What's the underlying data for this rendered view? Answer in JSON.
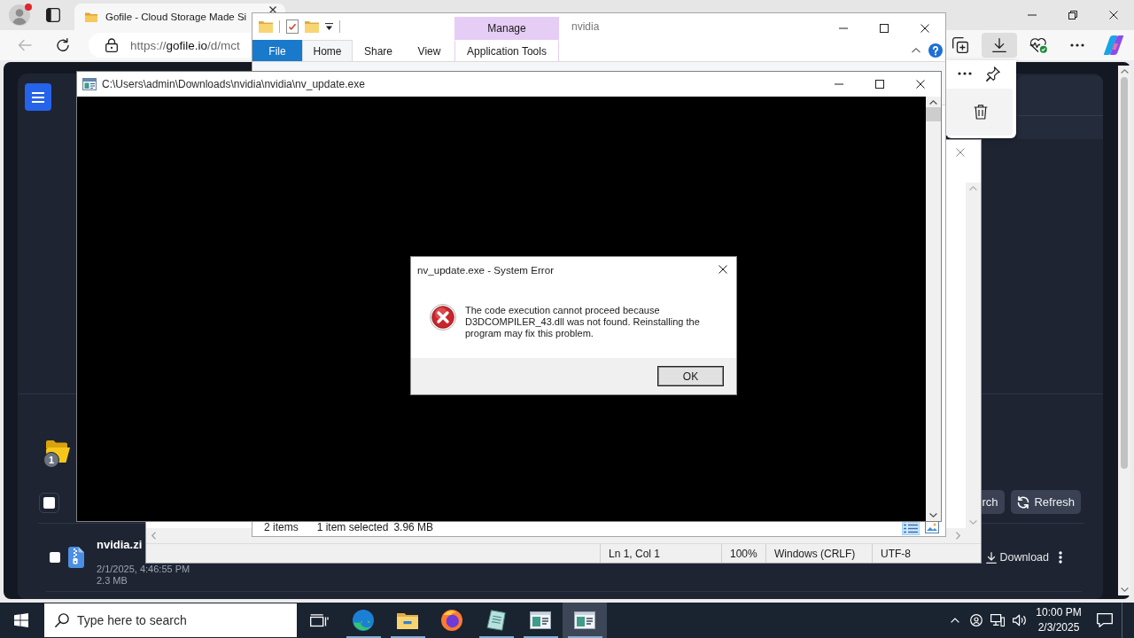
{
  "browser": {
    "profile": {
      "notification": true
    },
    "tab": {
      "title": "Gofile - Cloud Storage Made Si",
      "selected": true
    },
    "back": {
      "disabled": true
    },
    "url_parts": [
      {
        "kind": "scheme",
        "text": "https://"
      },
      {
        "kind": "host",
        "text": "gofile.io"
      },
      {
        "kind": "path",
        "text": "/d/mct"
      }
    ],
    "toolbar": [
      {
        "kind": "collections",
        "selected": false
      },
      {
        "kind": "downloads",
        "selected": true
      },
      {
        "kind": "essentials",
        "selected": false
      },
      {
        "kind": "more",
        "selected": false
      },
      {
        "kind": "copilot",
        "selected": false
      }
    ],
    "page": {
      "folder_count": "1",
      "select_all": {
        "checked": false
      },
      "actions": [
        {
          "kind": "text",
          "label": "rch"
        },
        {
          "kind": "refresh",
          "label": "Refresh"
        }
      ],
      "files": [
        {
          "name": "nvidia.zi",
          "date": "2/1/2025, 4:46:55 PM",
          "size": "2.3 MB",
          "checked": false,
          "action": "Download"
        }
      ]
    }
  },
  "explorer": {
    "title": "nvidia",
    "context_header": "Manage",
    "tabs": [
      {
        "label": "File",
        "kind": "file",
        "selected": false
      },
      {
        "label": "Home",
        "kind": "tab",
        "selected": true
      },
      {
        "label": "Share",
        "kind": "tab",
        "selected": false
      },
      {
        "label": "View",
        "kind": "tab",
        "selected": false
      },
      {
        "label": "Application Tools",
        "kind": "context",
        "selected": false
      }
    ],
    "status": [
      "2 items",
      "1 item selected",
      "3.96 MB"
    ],
    "views": [
      {
        "kind": "details",
        "selected": true
      },
      {
        "kind": "large-icons",
        "selected": false
      }
    ]
  },
  "console": {
    "title": "C:\\Users\\admin\\Downloads\\nvidia\\nvidia\\nv_update.exe"
  },
  "dialog": {
    "title": "nv_update.exe - System Error",
    "message": "The code execution cannot proceed because D3DCOMPILER_43.dll was not found. Reinstalling the program may fix this problem.",
    "button": "OK"
  },
  "notepad": {
    "status": [
      "Ln 1, Col 1",
      "100%",
      "Windows (CRLF)",
      "UTF-8"
    ]
  },
  "taskbar": {
    "search_placeholder": "Type here to search",
    "apps": [
      {
        "kind": "task-view",
        "running": false,
        "selected": false
      },
      {
        "kind": "edge",
        "running": true,
        "selected": false
      },
      {
        "kind": "explorer",
        "running": true,
        "selected": false
      },
      {
        "kind": "firefox",
        "running": false,
        "selected": false
      },
      {
        "kind": "notepad",
        "running": true,
        "selected": false
      },
      {
        "kind": "console",
        "running": true,
        "selected": false
      },
      {
        "kind": "console",
        "running": true,
        "selected": true
      }
    ],
    "time": "10:00 PM",
    "date": "2/3/2025"
  }
}
